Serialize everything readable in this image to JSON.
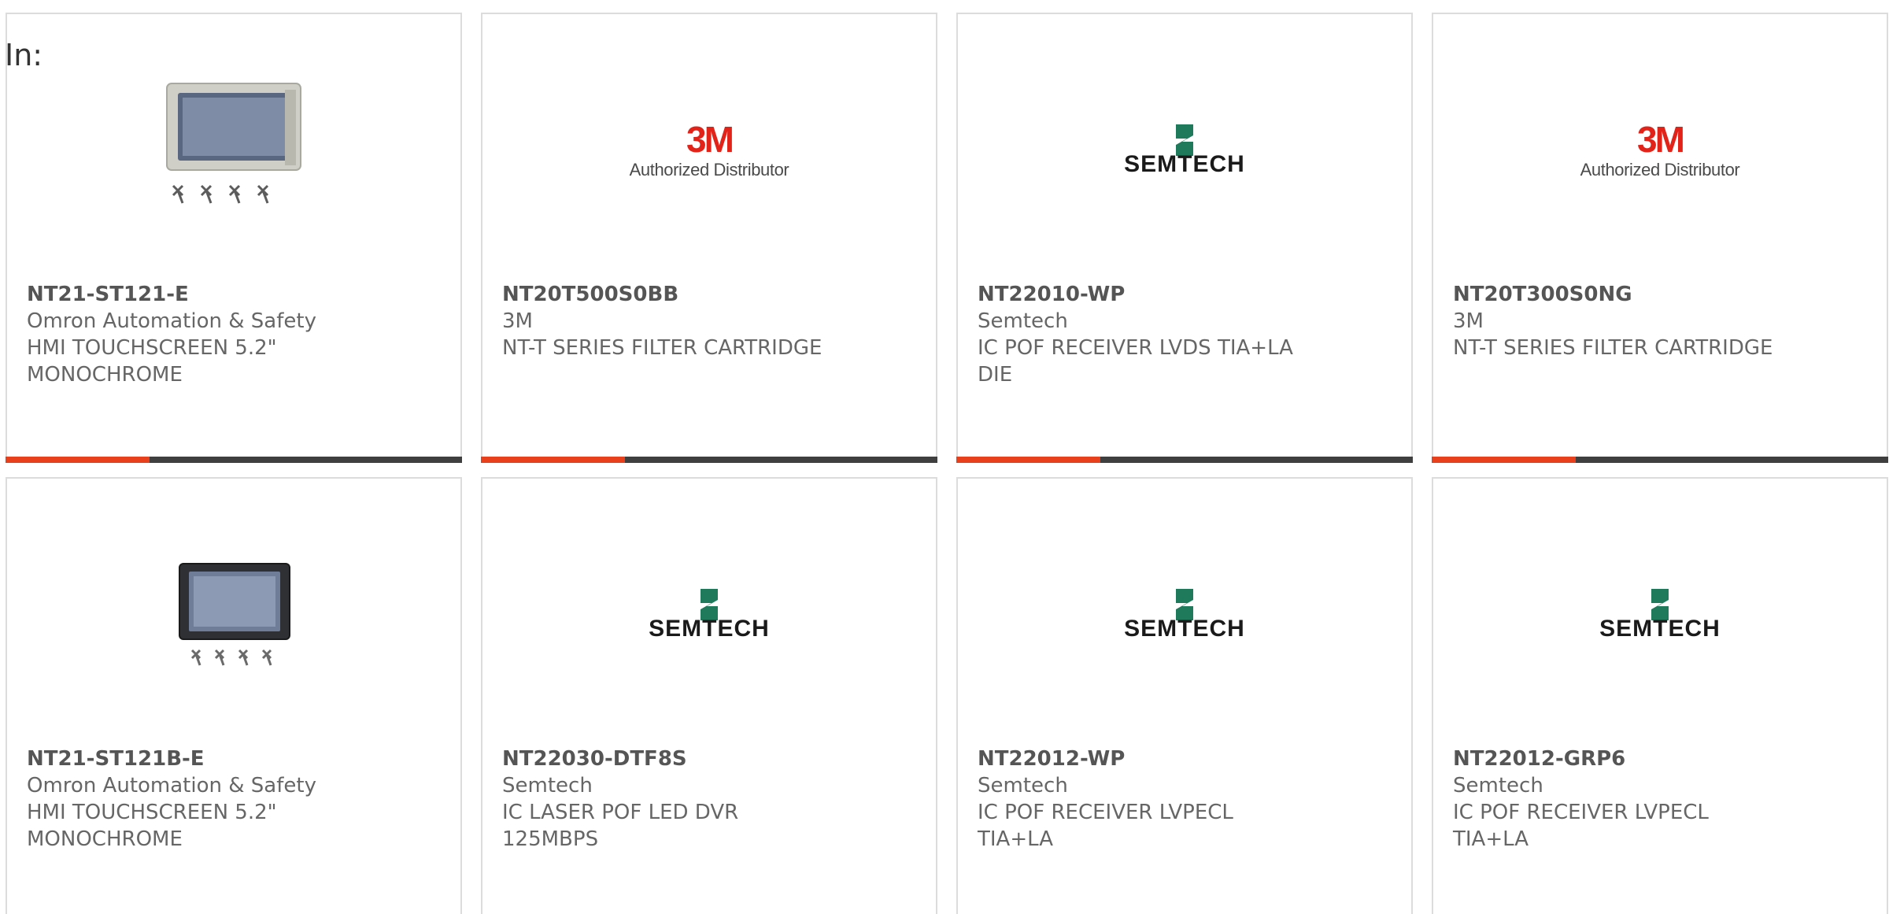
{
  "filter": {
    "label": "In:"
  },
  "products": [
    {
      "part_number": "NT21-ST121-E",
      "manufacturer": "Omron Automation & Safety",
      "description": "HMI TOUCHSCREEN 5.2\" MONOCHROME",
      "image": "hmi-panel-beige-icon"
    },
    {
      "part_number": "NT20T500S0BB",
      "manufacturer": "3M",
      "description": "NT-T SERIES FILTER CARTRIDGE",
      "image": "3m-logo-icon",
      "logo_mark": "3M",
      "logo_caption": "Authorized Distributor"
    },
    {
      "part_number": "NT22010-WP",
      "manufacturer": "Semtech",
      "description": "IC POF RECEIVER LVDS TIA+LA DIE",
      "image": "semtech-logo-icon",
      "logo_word": "SEMTECH"
    },
    {
      "part_number": "NT20T300S0NG",
      "manufacturer": "3M",
      "description": "NT-T SERIES FILTER CARTRIDGE",
      "image": "3m-logo-icon",
      "logo_mark": "3M",
      "logo_caption": "Authorized Distributor"
    },
    {
      "part_number": "NT21-ST121B-E",
      "manufacturer": "Omron Automation & Safety",
      "description": "HMI TOUCHSCREEN 5.2\" MONOCHROME",
      "image": "hmi-panel-black-icon"
    },
    {
      "part_number": "NT22030-DTF8S",
      "manufacturer": "Semtech",
      "description": "IC LASER POF LED DVR 125MBPS",
      "image": "semtech-logo-icon",
      "logo_word": "SEMTECH"
    },
    {
      "part_number": "NT22012-WP",
      "manufacturer": "Semtech",
      "description": "IC POF RECEIVER LVPECL TIA+LA",
      "image": "semtech-logo-icon",
      "logo_word": "SEMTECH"
    },
    {
      "part_number": "NT22012-GRP6",
      "manufacturer": "Semtech",
      "description": "IC POF RECEIVER LVPECL TIA+LA",
      "image": "semtech-logo-icon",
      "logo_word": "SEMTECH"
    }
  ],
  "colors": {
    "accent": "#e8401c",
    "bar": "#3f3f3f",
    "border": "#dcdcdc",
    "text": "#666666",
    "semtech_green": "#1f7a5c",
    "brand_3m": "#e2231a"
  }
}
